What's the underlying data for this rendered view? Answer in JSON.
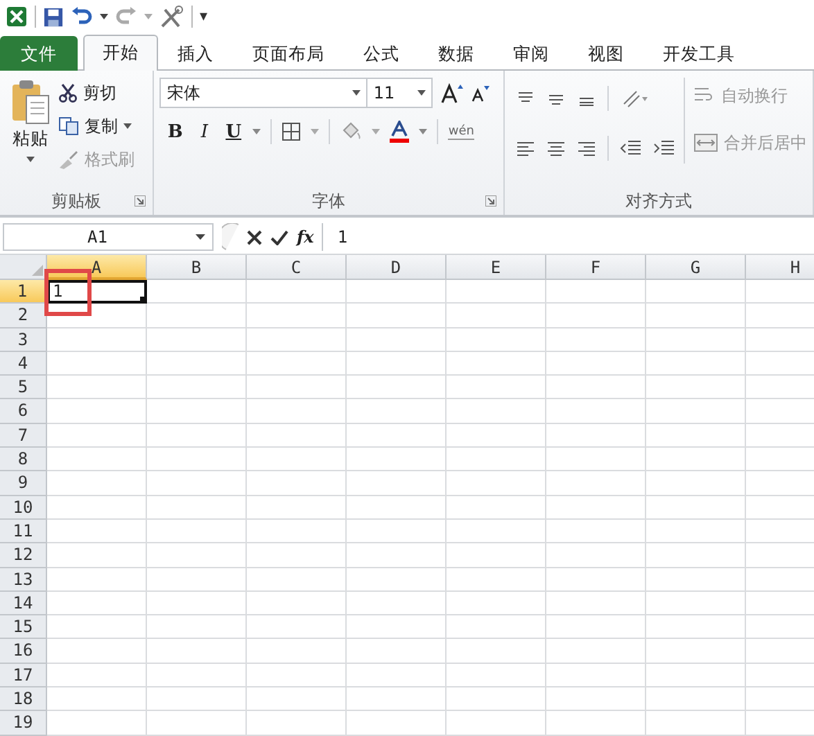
{
  "quick_access": {
    "customize_glyph": "▾"
  },
  "tabs": [
    {
      "label": "文件",
      "kind": "file",
      "selected": false
    },
    {
      "label": "开始",
      "kind": "tab",
      "selected": true
    },
    {
      "label": "插入",
      "kind": "tab",
      "selected": false
    },
    {
      "label": "页面布局",
      "kind": "tab",
      "selected": false
    },
    {
      "label": "公式",
      "kind": "tab",
      "selected": false
    },
    {
      "label": "数据",
      "kind": "tab",
      "selected": false
    },
    {
      "label": "审阅",
      "kind": "tab",
      "selected": false
    },
    {
      "label": "视图",
      "kind": "tab",
      "selected": false
    },
    {
      "label": "开发工具",
      "kind": "tab",
      "selected": false
    }
  ],
  "clipboard": {
    "paste": "粘贴",
    "cut": "剪切",
    "copy": "复制",
    "format_painter": {
      "label": "格式刷",
      "disabled": true
    },
    "title": "剪贴板"
  },
  "font": {
    "name": "宋体",
    "size": "11",
    "bold": "B",
    "italic": "I",
    "underline": "U",
    "phonetic": "wén",
    "title": "字体"
  },
  "alignment": {
    "wrap_text": {
      "label": "自动换行",
      "disabled": true
    },
    "merge_center": {
      "label": "合并后居中",
      "disabled": true
    },
    "title": "对齐方式"
  },
  "formula_bar": {
    "name_box": "A1",
    "fx": "fx",
    "value": "1"
  },
  "columns": [
    {
      "label": "A",
      "selected": true
    },
    {
      "label": "B",
      "selected": false
    },
    {
      "label": "C",
      "selected": false
    },
    {
      "label": "D",
      "selected": false
    },
    {
      "label": "E",
      "selected": false
    },
    {
      "label": "F",
      "selected": false
    },
    {
      "label": "G",
      "selected": false
    },
    {
      "label": "H",
      "selected": false
    }
  ],
  "rows": [
    {
      "label": "1",
      "selected": true,
      "cells": [
        {
          "value": "1",
          "active": true,
          "highlighted": true
        }
      ]
    },
    {
      "label": "2",
      "selected": false
    },
    {
      "label": "3",
      "selected": false
    },
    {
      "label": "4",
      "selected": false
    },
    {
      "label": "5",
      "selected": false
    },
    {
      "label": "6",
      "selected": false
    },
    {
      "label": "7",
      "selected": false
    },
    {
      "label": "8",
      "selected": false
    },
    {
      "label": "9",
      "selected": false
    },
    {
      "label": "10",
      "selected": false
    },
    {
      "label": "11",
      "selected": false
    },
    {
      "label": "12",
      "selected": false
    },
    {
      "label": "13",
      "selected": false
    },
    {
      "label": "14",
      "selected": false
    },
    {
      "label": "15",
      "selected": false
    },
    {
      "label": "16",
      "selected": false
    },
    {
      "label": "17",
      "selected": false
    },
    {
      "label": "18",
      "selected": false
    },
    {
      "label": "19",
      "selected": false
    }
  ]
}
